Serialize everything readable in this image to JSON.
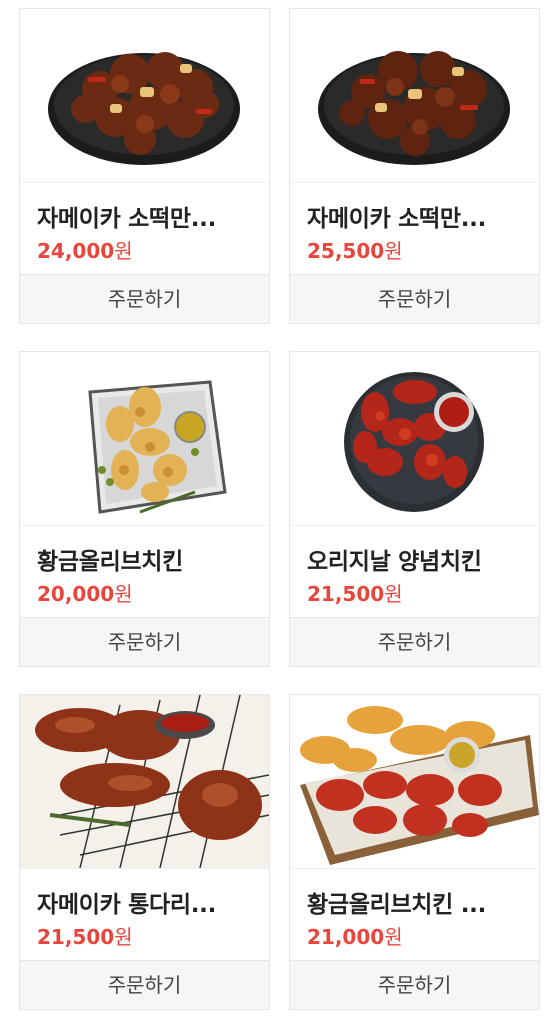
{
  "products": [
    {
      "name": "자메이카 소떡만...",
      "price": "24,000",
      "currency": "원",
      "order_label": "주문하기",
      "image": "jamaica-sotteok-chicken-plate"
    },
    {
      "name": "자메이카 소떡만...",
      "price": "25,500",
      "currency": "원",
      "order_label": "주문하기",
      "image": "jamaica-sotteok-chicken-plate"
    },
    {
      "name": "황금올리브치킨",
      "price": "20,000",
      "currency": "원",
      "order_label": "주문하기",
      "image": "golden-olive-fried-chicken-tray"
    },
    {
      "name": "오리지날 양념치킨",
      "price": "21,500",
      "currency": "원",
      "order_label": "주문하기",
      "image": "original-yangnyeom-chicken-plate"
    },
    {
      "name": "자메이카 통다리...",
      "price": "21,500",
      "currency": "원",
      "order_label": "주문하기",
      "image": "jamaica-chicken-legs-on-grill"
    },
    {
      "name": "황금올리브치킨 ...",
      "price": "21,000",
      "currency": "원",
      "order_label": "주문하기",
      "image": "golden-olive-half-half-platter"
    }
  ],
  "colors": {
    "price": "#e8453c",
    "button_bg": "#f5f6f8",
    "border": "#e3e6ea"
  }
}
